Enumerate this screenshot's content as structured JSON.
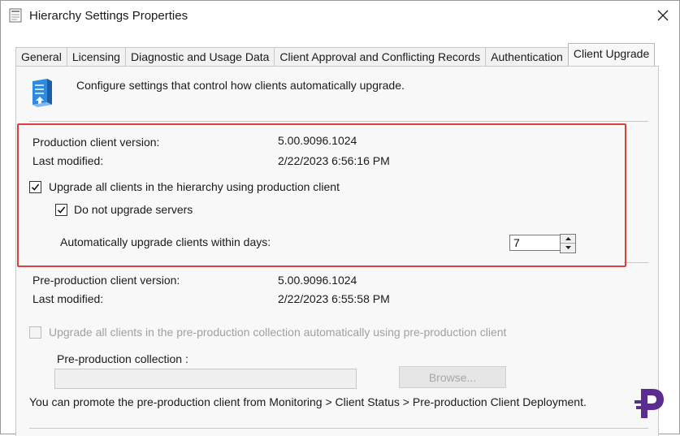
{
  "window": {
    "title": "Hierarchy Settings Properties"
  },
  "tabs": [
    {
      "label": "General"
    },
    {
      "label": "Licensing"
    },
    {
      "label": "Diagnostic and Usage Data"
    },
    {
      "label": "Client Approval and Conflicting Records"
    },
    {
      "label": "Authentication"
    },
    {
      "label": "Client Upgrade"
    }
  ],
  "header": {
    "description": "Configure settings that control how clients automatically upgrade."
  },
  "production": {
    "version_label": "Production client version:",
    "version_value": "5.00.9096.1024",
    "modified_label": "Last modified:",
    "modified_value": "2/22/2023 6:56:16 PM",
    "upgrade_all_label": "Upgrade all clients in the hierarchy using production client",
    "upgrade_all_checked": true,
    "no_servers_label": "Do not upgrade servers",
    "no_servers_checked": true,
    "days_label": "Automatically upgrade clients within days:",
    "days_value": "7"
  },
  "preproduction": {
    "version_label": "Pre-production client version:",
    "version_value": "5.00.9096.1024",
    "modified_label": "Last modified:",
    "modified_value": "2/22/2023 6:55:58 PM",
    "upgrade_label": "Upgrade all clients in the pre-production collection automatically using pre-production client",
    "upgrade_checked": false,
    "collection_label": "Pre-production collection :",
    "collection_value": "",
    "browse_label": "Browse...",
    "note": "You can promote the pre-production client from Monitoring > Client Status > Pre-production Client Deployment."
  },
  "colors": {
    "highlight_box": "#d9413c",
    "logo": "#5b2d8e"
  }
}
